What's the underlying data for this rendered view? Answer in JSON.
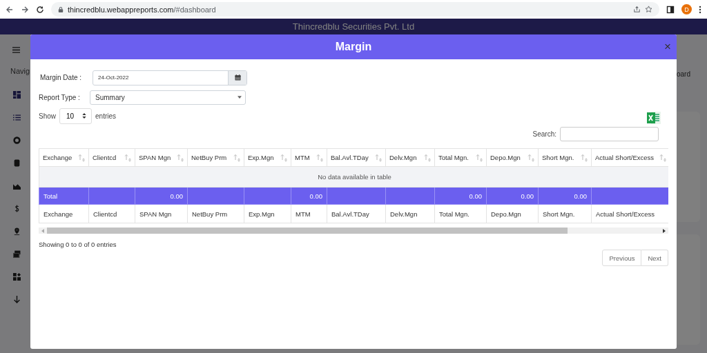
{
  "browser": {
    "url_host": "thincredblu.webappreports.com",
    "url_path": "/#dashboard",
    "profile_initial": "D"
  },
  "app_header": {
    "title": "Thincredblu Securities Pvt. Ltd"
  },
  "background": {
    "nav_label": "Navig",
    "tab_label": "oard"
  },
  "modal": {
    "title": "Margin",
    "close": "×",
    "margin_date": {
      "label": "Margin Date :",
      "value": "24-Oct-2022"
    },
    "report_type": {
      "label": "Report Type :",
      "value": "Summary"
    },
    "page_length": {
      "prefix": "Show",
      "value": "10",
      "suffix": "entries"
    },
    "search": {
      "label": "Search:"
    },
    "columns": [
      "Exchange",
      "Clientcd",
      "SPAN Mgn",
      "NetBuy Prm",
      "Exp.Mgn",
      "MTM",
      "Bal.Avl.TDay",
      "Delv.Mgn",
      "Total Mgn.",
      "Depo.Mgn",
      "Short Mgn.",
      "Actual Short/Excess"
    ],
    "empty_message": "No data available in table",
    "total_row": {
      "label": "Total",
      "span_mgn": "0.00",
      "mtm": "0.00",
      "total_mgn": "0.00",
      "depo_mgn": "0.00",
      "short_mgn": "0.00"
    },
    "footer_columns": [
      "Exchange",
      "Clientcd",
      "SPAN Mgn",
      "NetBuy Prm",
      "Exp.Mgn",
      "MTM",
      "Bal.Avl.TDay",
      "Delv.Mgn",
      "Total Mgn.",
      "Depo.Mgn",
      "Short Mgn.",
      "Actual Short/Excess"
    ],
    "info": "Showing 0 to 0 of 0 entries",
    "pagination": [
      {
        "label": "Previous",
        "disabled": true
      },
      {
        "label": "Next",
        "disabled": true
      }
    ]
  }
}
